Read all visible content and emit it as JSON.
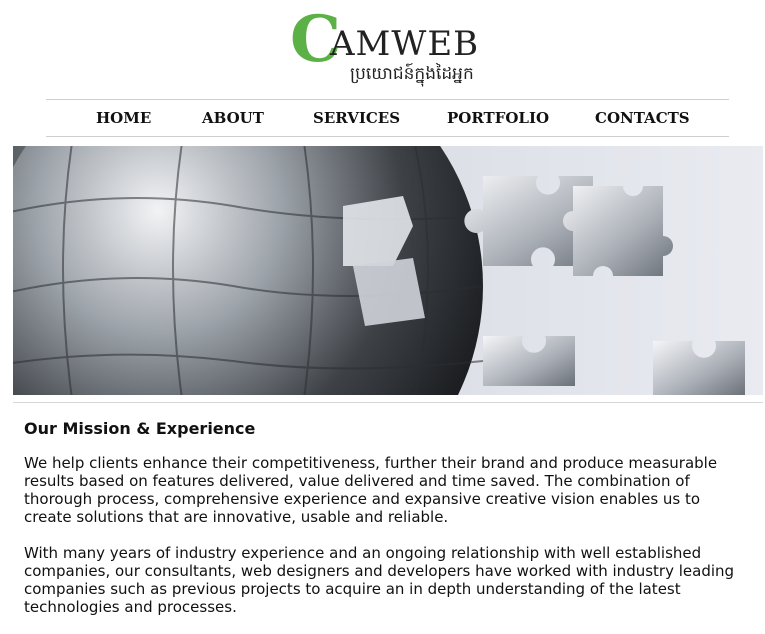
{
  "logo": {
    "initial": "C",
    "word": "AMWEB",
    "subtitle": "ប្រយោជន៍ក្នុងដៃអ្នក"
  },
  "nav": {
    "items": [
      "HOME",
      "ABOUT",
      "SERVICES",
      "PORTFOLIO",
      "CONTACTS"
    ]
  },
  "banner": {
    "image_description": "puzzle-globe-banner"
  },
  "content": {
    "heading": "Our Mission & Experience",
    "paragraph1": "We help clients enhance their competitiveness, further their brand and produce measurable results based on features delivered, value delivered and time saved. The combination of thorough process, comprehensive experience and expansive creative vision enables us to create solutions that are innovative, usable and reliable.",
    "paragraph2": "With many years of industry experience and an ongoing relationship with well established companies, our consultants, web designers and developers have worked with industry leading companies such as previous projects to acquire an in depth understanding of the latest technologies and processes."
  },
  "colors": {
    "brand_green": "#5bb046",
    "text": "#111111",
    "divider": "#cfcfcf"
  }
}
